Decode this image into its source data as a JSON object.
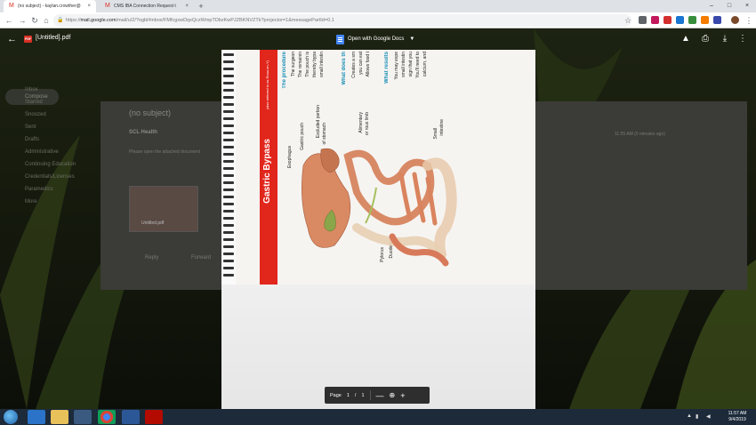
{
  "browser": {
    "tabs": [
      {
        "label": "(no subject) - kaylan.crowther@",
        "active": true
      },
      {
        "label": "CMS IBA Connection Request t",
        "active": false
      }
    ],
    "url_prefix": "https://",
    "url_host": "mail.google.com",
    "url_path": "/mail/u/2/?ogbl#inbox/FMfcgxwDqxQczWmpTDbzKwPJZBKNVZTk?projector=1&messagePartId=0.1"
  },
  "viewer": {
    "file_title": "[Untitled].pdf",
    "pdf_badge": "PDF",
    "open_with_label": "Open with Google Docs"
  },
  "background_mail": {
    "compose": "Compose",
    "subject": "(no subject)",
    "sender": "SCL Health",
    "body_line": "Please open the attached document",
    "reply": "Reply",
    "forward": "Forward",
    "attachment": "Untitled.pdf",
    "time": "11:55 AM (0 minutes ago)",
    "sidebar": [
      "Inbox",
      "Starred",
      "Snoozed",
      "Sent",
      "Drafts",
      "Administrative",
      "Continuing Education",
      "Credentials/Licenses",
      "Paramedics",
      "More"
    ]
  },
  "document": {
    "title": "Gastric Bypass",
    "subtitle": "(also referred to as Roux-en-Y)",
    "heading1": "The procedure",
    "bullets1": [
      "The surgeon",
      "The remainin",
      "The pouch is",
      "thereby bypa",
      "small intestin"
    ],
    "heading2": "What does th",
    "bullets2": [
      "Creates a sm",
      "you can eat",
      "Allows food t"
    ],
    "heading3": "What results",
    "bullets3": [
      "You may expe",
      "small intestin",
      "sign that you",
      "You'll need to",
      "calcium, and"
    ],
    "labels": {
      "esophagus": "Esophagus",
      "gastric_pouch": "Gastric pouch",
      "excluded1": "Excluded portion",
      "excluded2": "of stomach",
      "alimentary1": "Alimentary",
      "alimentary2": "or roux limb",
      "small1": "Small",
      "small2": "intestine",
      "pylorus": "Pylorus",
      "duodenum": "Duodenum"
    }
  },
  "page_controls": {
    "page_label": "Page",
    "current": "1",
    "separator": "/",
    "total": "1",
    "zoom_out": "—",
    "zoom_in": "+"
  },
  "taskbar": {
    "time": "11:57 AM",
    "date": "9/4/2019"
  }
}
